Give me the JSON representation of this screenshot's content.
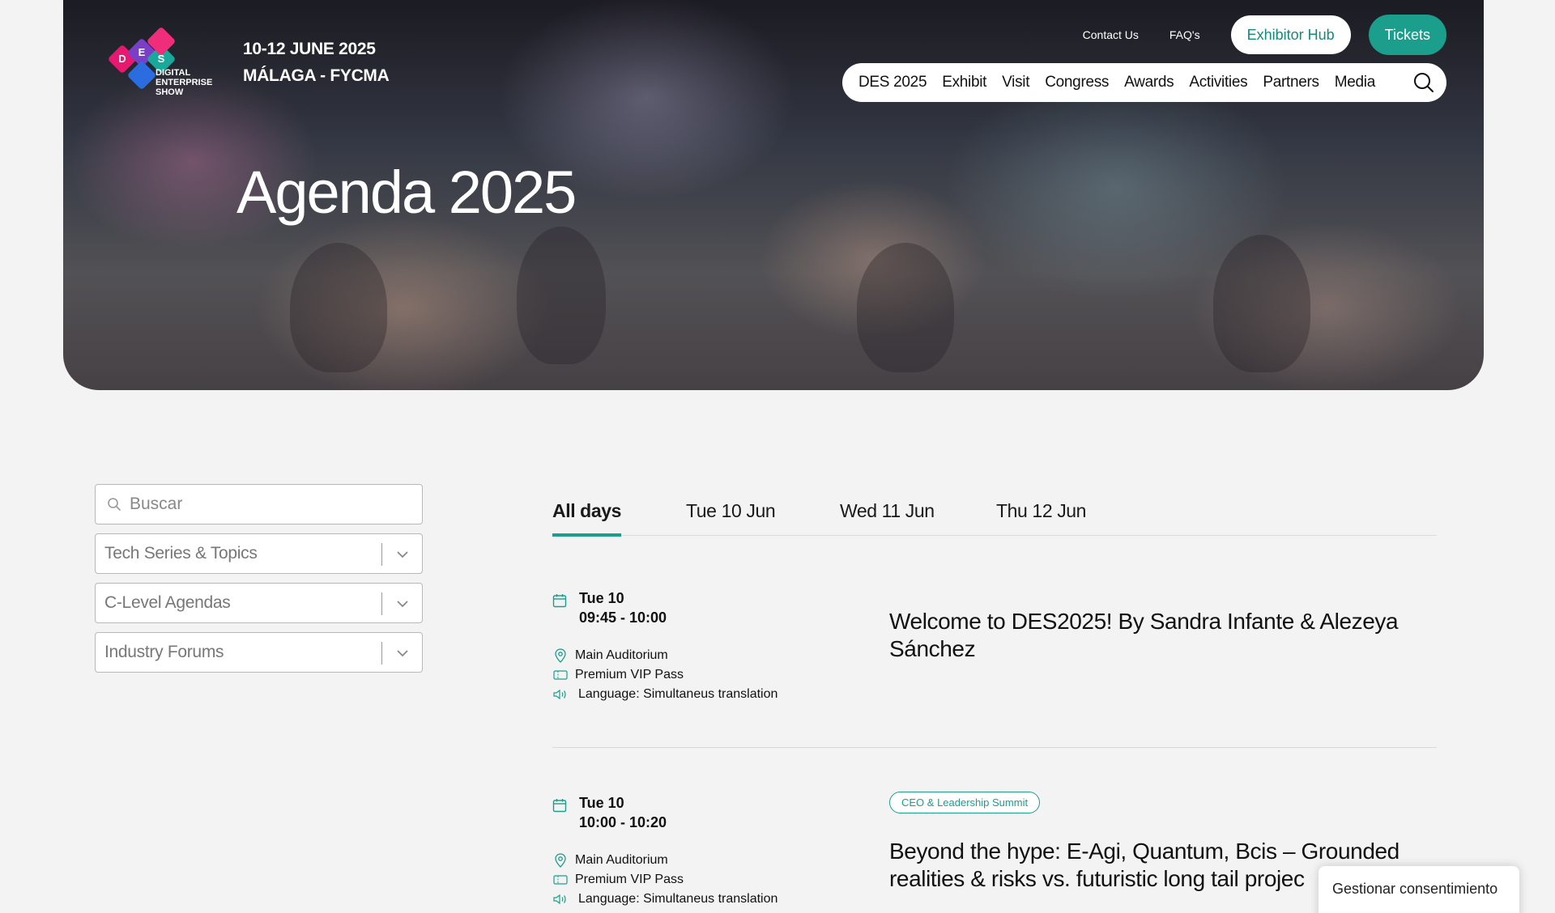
{
  "hero": {
    "logo_letters": [
      "D",
      "E",
      "S"
    ],
    "logo_lines": [
      "DIGITAL",
      "ENTERPRISE",
      "SHOW"
    ],
    "dates": "10-12 JUNE 2025",
    "location": "MÁLAGA - FYCMA",
    "title": "Agenda 2025"
  },
  "top_links": {
    "contact": "Contact Us",
    "faqs": "FAQ's",
    "exhibitor_hub": "Exhibitor Hub",
    "tickets": "Tickets"
  },
  "nav": {
    "items": [
      "DES 2025",
      "Exhibit",
      "Visit",
      "Congress",
      "Awards",
      "Activities",
      "Partners",
      "Media"
    ]
  },
  "filters": {
    "search_placeholder": "Buscar",
    "selects": [
      "Tech Series & Topics",
      "C-Level Agendas",
      "Industry Forums"
    ]
  },
  "tabs": [
    "All days",
    "Tue 10 Jun",
    "Wed 11 Jun",
    "Thu 12 Jun"
  ],
  "sessions": [
    {
      "day": "Tue 10",
      "time": "09:45 - 10:00",
      "location": "Main Auditorium",
      "pass": "Premium VIP Pass",
      "language": "Language: Simultaneus translation",
      "badge": "",
      "title": "Welcome to DES2025! By Sandra Infante & Alezeya Sánchez"
    },
    {
      "day": "Tue 10",
      "time": "10:00 - 10:20",
      "location": "Main Auditorium",
      "pass": "Premium VIP Pass",
      "language": "Language: Simultaneus translation",
      "badge": "CEO & Leadership Summit",
      "title": "Beyond the hype: E-Agi, Quantum, Bcis – Grounded realities & risks vs. futuristic long tail projec"
    }
  ],
  "consent": "Gestionar consentimiento",
  "colors": {
    "accent": "#1b9e8c",
    "background": "#f3f3f3"
  }
}
